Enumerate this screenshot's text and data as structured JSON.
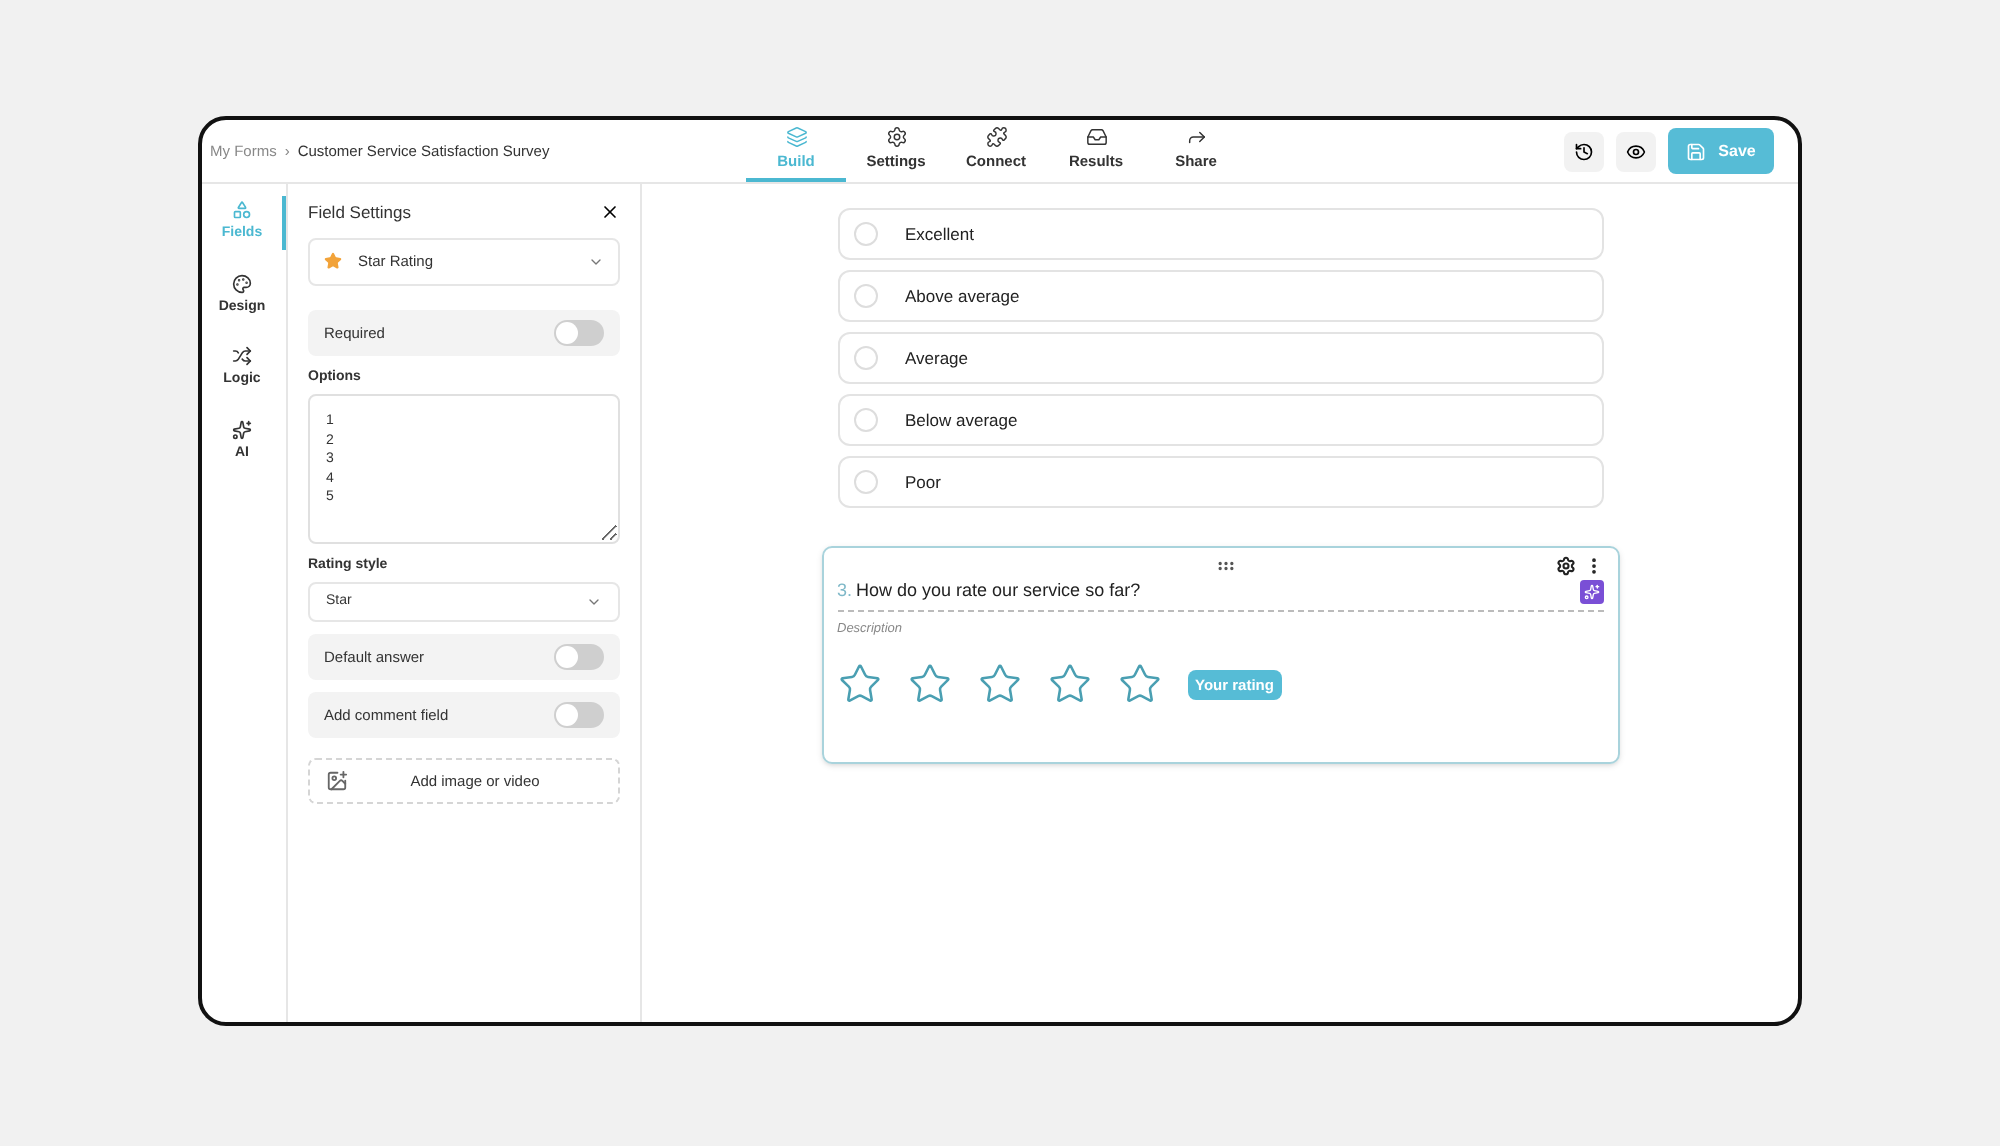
{
  "breadcrumb": {
    "items": [
      "My Forms",
      "Customer Service Satisfaction Survey"
    ],
    "separator": "›"
  },
  "tabs": [
    {
      "label": "Build",
      "selected": true
    },
    {
      "label": "Settings",
      "selected": false
    },
    {
      "label": "Connect",
      "selected": false
    },
    {
      "label": "Results",
      "selected": false
    },
    {
      "label": "Share",
      "selected": false
    }
  ],
  "save_button": "Save",
  "sidebar": {
    "items": [
      {
        "label": "Fields",
        "selected": true
      },
      {
        "label": "Design",
        "selected": false
      },
      {
        "label": "Logic",
        "selected": false
      },
      {
        "label": "AI",
        "selected": false
      }
    ]
  },
  "field_settings": {
    "title": "Field Settings",
    "field_type": "Star Rating",
    "required": {
      "label": "Required",
      "on": false
    },
    "options": {
      "label": "Options",
      "value": "1\n2\n3\n4\n5"
    },
    "rating_style": {
      "label": "Rating style",
      "value": "Star"
    },
    "toggles": [
      {
        "label": "Default answer",
        "on": false
      },
      {
        "label": "Add comment field",
        "on": false
      }
    ],
    "add_media": "Add image or video"
  },
  "choices": [
    {
      "label": "Excellent",
      "selected": false
    },
    {
      "label": "Above average",
      "selected": false
    },
    {
      "label": "Average",
      "selected": false
    },
    {
      "label": "Below average",
      "selected": false
    },
    {
      "label": "Poor",
      "selected": false
    }
  ],
  "question": {
    "number": "3.",
    "title": "How do you rate our service so far?",
    "description": "Description",
    "stars": 0,
    "badge": "Your rating"
  }
}
